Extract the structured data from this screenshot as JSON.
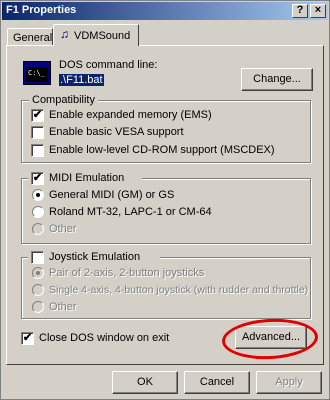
{
  "window": {
    "title": "F1 Properties",
    "help_btn": "?",
    "close_btn": "×"
  },
  "tabs": [
    {
      "label": "General"
    },
    {
      "label": "VDMSound"
    }
  ],
  "dos": {
    "label": "DOS command line:",
    "value": ".\\F11.bat",
    "icon_text": "C:\\_",
    "change_btn": "Change..."
  },
  "compatibility": {
    "title": "Compatibility",
    "options": [
      {
        "label": "Enable expanded memory (EMS)",
        "checked": true
      },
      {
        "label": "Enable basic VESA support",
        "checked": false
      },
      {
        "label": "Enable low-level CD-ROM support (MSCDEX)",
        "checked": false
      }
    ]
  },
  "midi": {
    "title": "MIDI Emulation",
    "checked": true,
    "options": [
      {
        "label": "General MIDI (GM) or GS",
        "selected": true,
        "disabled": false
      },
      {
        "label": "Roland MT-32, LAPC-1 or CM-64",
        "selected": false,
        "disabled": false
      },
      {
        "label": "Other",
        "selected": false,
        "disabled": true
      }
    ]
  },
  "joystick": {
    "title": "Joystick Emulation",
    "checked": false,
    "options": [
      {
        "label": "Pair of 2-axis, 2-button joysticks",
        "selected": true,
        "disabled": true
      },
      {
        "label": "Single 4-axis, 4-button joystick (with rudder and throttle)",
        "selected": false,
        "disabled": true
      },
      {
        "label": "Other",
        "selected": false,
        "disabled": true
      }
    ]
  },
  "close_on_exit": {
    "label": "Close DOS window on exit",
    "checked": true
  },
  "advanced_btn": "Advanced...",
  "footer": {
    "ok": "OK",
    "cancel": "Cancel",
    "apply": "Apply"
  },
  "colors": {
    "annotation": "#e00000",
    "titlebar": "#0a246a",
    "face": "#d4d0c8"
  },
  "icons": {
    "tab_icon": "music-note-icon",
    "dos_icon": "ms-dos-icon"
  }
}
